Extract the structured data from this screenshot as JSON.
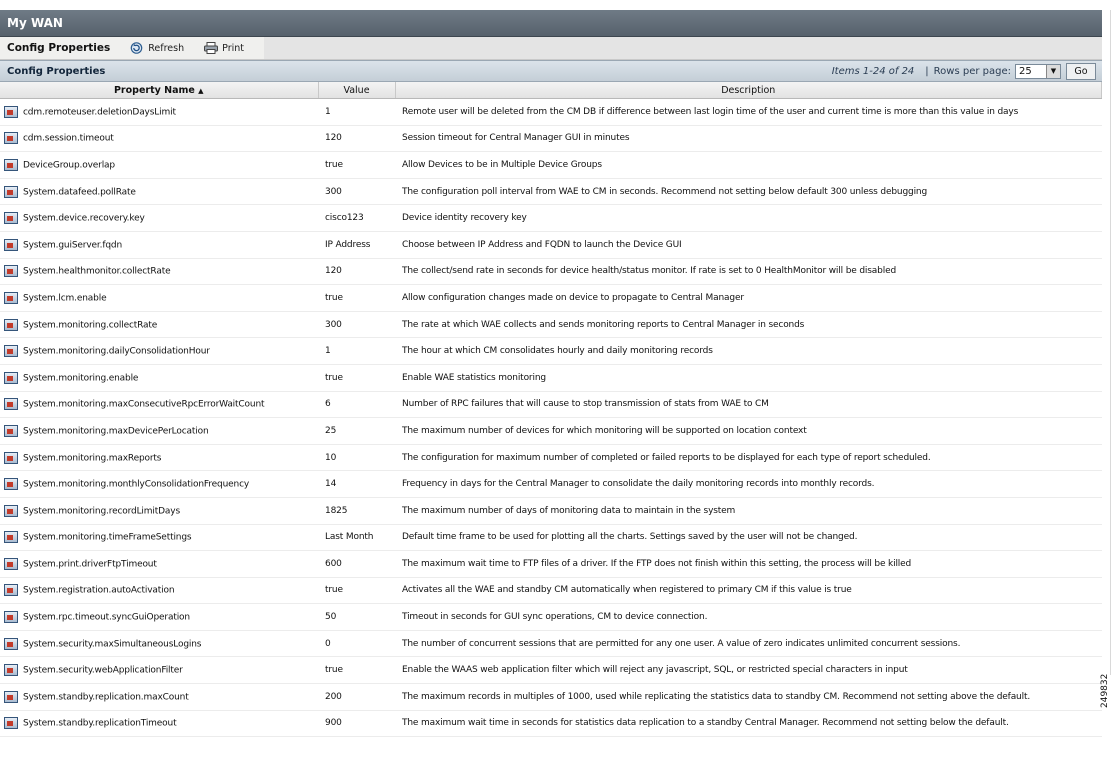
{
  "window": {
    "title": "My WAN"
  },
  "toolbar": {
    "title": "Config Properties",
    "refresh_label": "Refresh",
    "print_label": "Print"
  },
  "grid": {
    "title": "Config Properties",
    "items_text": "Items 1-24 of 24",
    "separator": "|",
    "rows_per_page_label": "Rows per page:",
    "rows_per_page_value": "25",
    "go_label": "Go",
    "columns": [
      "Property Name",
      "Value",
      "Description"
    ],
    "sort_indicator": "▲"
  },
  "rows": [
    {
      "name": "cdm.remoteuser.deletionDaysLimit",
      "value": "1",
      "desc": "Remote user will be deleted from the CM DB if difference between last login time of the user and current time is more than this value in days"
    },
    {
      "name": "cdm.session.timeout",
      "value": "120",
      "desc": "Session timeout for Central Manager GUI in minutes"
    },
    {
      "name": "DeviceGroup.overlap",
      "value": "true",
      "desc": "Allow Devices to be in Multiple Device Groups"
    },
    {
      "name": "System.datafeed.pollRate",
      "value": "300",
      "desc": "The configuration poll interval from WAE to CM in seconds. Recommend not setting below default 300 unless debugging"
    },
    {
      "name": "System.device.recovery.key",
      "value": "cisco123",
      "desc": "Device identity recovery key"
    },
    {
      "name": "System.guiServer.fqdn",
      "value": "IP Address",
      "desc": "Choose between IP Address and FQDN to launch the Device GUI"
    },
    {
      "name": "System.healthmonitor.collectRate",
      "value": "120",
      "desc": "The collect/send rate in seconds for device health/status monitor. If rate is set to 0 HealthMonitor will be disabled"
    },
    {
      "name": "System.lcm.enable",
      "value": "true",
      "desc": "Allow configuration changes made on device to propagate to Central Manager"
    },
    {
      "name": "System.monitoring.collectRate",
      "value": "300",
      "desc": "The rate at which WAE collects and sends monitoring reports to Central Manager in seconds"
    },
    {
      "name": "System.monitoring.dailyConsolidationHour",
      "value": "1",
      "desc": "The hour at which CM consolidates hourly and daily monitoring records"
    },
    {
      "name": "System.monitoring.enable",
      "value": "true",
      "desc": "Enable WAE statistics monitoring"
    },
    {
      "name": "System.monitoring.maxConsecutiveRpcErrorWaitCount",
      "value": "6",
      "desc": "Number of RPC failures that will cause to stop transmission of stats from WAE to CM"
    },
    {
      "name": "System.monitoring.maxDevicePerLocation",
      "value": "25",
      "desc": "The maximum number of devices for which monitoring will be supported on location context"
    },
    {
      "name": "System.monitoring.maxReports",
      "value": "10",
      "desc": "The configuration for maximum number of completed or failed reports to be displayed for each type of report scheduled."
    },
    {
      "name": "System.monitoring.monthlyConsolidationFrequency",
      "value": "14",
      "desc": "Frequency in days for the Central Manager to consolidate the daily monitoring records into monthly records."
    },
    {
      "name": "System.monitoring.recordLimitDays",
      "value": "1825",
      "desc": "The maximum number of days of monitoring data to maintain in the system"
    },
    {
      "name": "System.monitoring.timeFrameSettings",
      "value": "Last Month",
      "desc": "Default time frame to be used for plotting all the charts. Settings saved by the user will not be changed."
    },
    {
      "name": "System.print.driverFtpTimeout",
      "value": "600",
      "desc": "The maximum wait time to FTP files of a driver. If the FTP does not finish within this setting, the process will be killed"
    },
    {
      "name": "System.registration.autoActivation",
      "value": "true",
      "desc": "Activates all the WAE and standby CM automatically when registered to primary CM if this value is true"
    },
    {
      "name": "System.rpc.timeout.syncGuiOperation",
      "value": "50",
      "desc": "Timeout in seconds for GUI sync operations, CM to device connection."
    },
    {
      "name": "System.security.maxSimultaneousLogins",
      "value": "0",
      "desc": "The number of concurrent sessions that are permitted for any one user. A value of zero indicates unlimited concurrent sessions."
    },
    {
      "name": "System.security.webApplicationFilter",
      "value": "true",
      "desc": "Enable the WAAS web application filter which will reject any javascript, SQL, or restricted special characters in input"
    },
    {
      "name": "System.standby.replication.maxCount",
      "value": "200",
      "desc": "The maximum records in multiples of 1000, used while replicating the statistics data to standby CM. Recommend not setting above the default."
    },
    {
      "name": "System.standby.replicationTimeout",
      "value": "900",
      "desc": "The maximum wait time in seconds for statistics data replication to a standby Central Manager. Recommend not setting below the default."
    }
  ],
  "figure_id": "249832",
  "icons": {
    "row": "property-icon",
    "refresh": "refresh-icon",
    "print": "print-icon",
    "dropdown": "chevron-down-icon"
  }
}
